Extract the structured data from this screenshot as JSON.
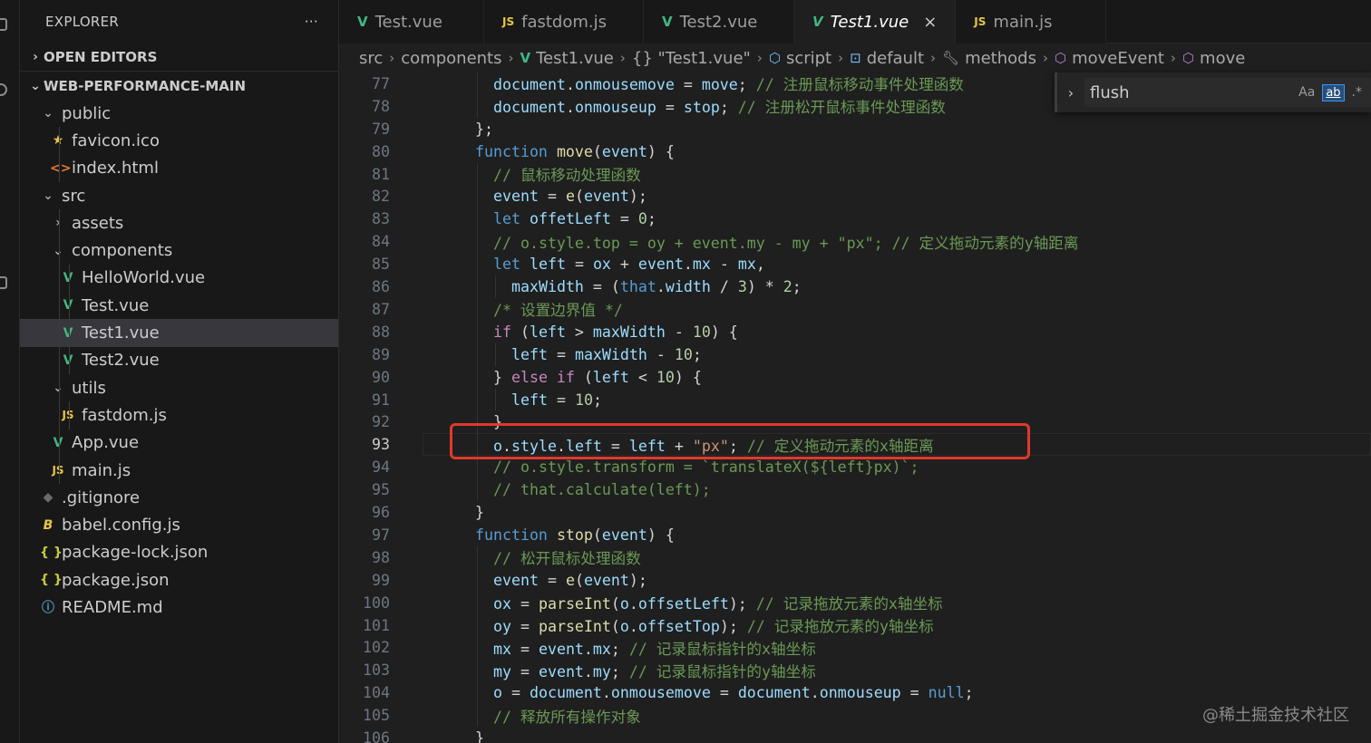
{
  "sidebar": {
    "title": "EXPLORER",
    "more": "···",
    "open_editors": "OPEN EDITORS",
    "project": "WEB-PERFORMANCE-MAIN",
    "items": [
      {
        "label": "public",
        "type": "folder-open",
        "depth": 1
      },
      {
        "label": "favicon.ico",
        "type": "star-file",
        "depth": 2
      },
      {
        "label": "index.html",
        "type": "html-file",
        "depth": 2
      },
      {
        "label": "src",
        "type": "folder-open",
        "depth": 1
      },
      {
        "label": "assets",
        "type": "folder-closed",
        "depth": 2
      },
      {
        "label": "components",
        "type": "folder-open",
        "depth": 2
      },
      {
        "label": "HelloWorld.vue",
        "type": "vue-file",
        "depth": 3
      },
      {
        "label": "Test.vue",
        "type": "vue-file",
        "depth": 3
      },
      {
        "label": "Test1.vue",
        "type": "vue-file",
        "depth": 3,
        "selected": true
      },
      {
        "label": "Test2.vue",
        "type": "vue-file",
        "depth": 3
      },
      {
        "label": "utils",
        "type": "folder-open",
        "depth": 2
      },
      {
        "label": "fastdom.js",
        "type": "js-file",
        "depth": 3
      },
      {
        "label": "App.vue",
        "type": "vue-file",
        "depth": 2
      },
      {
        "label": "main.js",
        "type": "js-file",
        "depth": 2
      },
      {
        "label": ".gitignore",
        "type": "git-file",
        "depth": 1
      },
      {
        "label": "babel.config.js",
        "type": "babel-file",
        "depth": 1
      },
      {
        "label": "package-lock.json",
        "type": "json-file",
        "depth": 1
      },
      {
        "label": "package.json",
        "type": "json-file",
        "depth": 1
      },
      {
        "label": "README.md",
        "type": "info-file",
        "depth": 1
      }
    ]
  },
  "tabs": [
    {
      "label": "Test.vue",
      "icon": "vue-icon"
    },
    {
      "label": "fastdom.js",
      "icon": "js-icon"
    },
    {
      "label": "Test2.vue",
      "icon": "vue-icon"
    },
    {
      "label": "Test1.vue",
      "icon": "vue-icon",
      "active": true
    },
    {
      "label": "main.js",
      "icon": "js-icon"
    }
  ],
  "icons": {
    "vue": "V",
    "js": "JS",
    "close": "×",
    "star": "★",
    "html": "<>",
    "json": "{ }",
    "babel": "B",
    "git": "◆",
    "info": "ⓘ"
  },
  "breadcrumb": {
    "src": "src",
    "components": "components",
    "file": "Test1.vue",
    "obj": "{} \"Test1.vue\"",
    "script": "script",
    "default": "default",
    "methods": "methods",
    "moveEvent": "moveEvent",
    "move": "move"
  },
  "find": {
    "query": "flush",
    "match_case": "Aa",
    "whole_word": "ab",
    "regex": ".*"
  },
  "editor": {
    "current_line": 93,
    "lines": [
      {
        "n": "77",
        "indent": 1,
        "tokens": [
          [
            "var",
            "document"
          ],
          [
            "pn",
            "."
          ],
          [
            "var",
            "onmousemove"
          ],
          [
            "pn",
            " = "
          ],
          [
            "var",
            "move"
          ],
          [
            "pn",
            "; "
          ],
          [
            "cm",
            "// 注册鼠标移动事件处理函数"
          ]
        ]
      },
      {
        "n": "78",
        "indent": 1,
        "tokens": [
          [
            "var",
            "document"
          ],
          [
            "pn",
            "."
          ],
          [
            "var",
            "onmouseup"
          ],
          [
            "pn",
            " = "
          ],
          [
            "var",
            "stop"
          ],
          [
            "pn",
            "; "
          ],
          [
            "cm",
            "// 注册松开鼠标事件处理函数"
          ]
        ]
      },
      {
        "n": "79",
        "indent": 0,
        "tokens": [
          [
            "pn",
            "};"
          ]
        ]
      },
      {
        "n": "80",
        "indent": 0,
        "tokens": [
          [
            "kw",
            "function"
          ],
          [
            "pn",
            " "
          ],
          [
            "fn",
            "move"
          ],
          [
            "pn",
            "("
          ],
          [
            "var",
            "event"
          ],
          [
            "pn",
            ") {"
          ]
        ]
      },
      {
        "n": "81",
        "indent": 1,
        "tokens": [
          [
            "cm",
            "// 鼠标移动处理函数"
          ]
        ]
      },
      {
        "n": "82",
        "indent": 1,
        "tokens": [
          [
            "var",
            "event"
          ],
          [
            "pn",
            " = "
          ],
          [
            "fn",
            "e"
          ],
          [
            "pn",
            "("
          ],
          [
            "var",
            "event"
          ],
          [
            "pn",
            ");"
          ]
        ]
      },
      {
        "n": "83",
        "indent": 1,
        "tokens": [
          [
            "kw",
            "let"
          ],
          [
            "pn",
            " "
          ],
          [
            "var",
            "offetLeft"
          ],
          [
            "pn",
            " = "
          ],
          [
            "num",
            "0"
          ],
          [
            "pn",
            ";"
          ]
        ]
      },
      {
        "n": "84",
        "indent": 1,
        "tokens": [
          [
            "cm",
            "// o.style.top = oy + event.my - my + \"px\"; // 定义拖动元素的y轴距离"
          ]
        ]
      },
      {
        "n": "85",
        "indent": 1,
        "tokens": [
          [
            "kw",
            "let"
          ],
          [
            "pn",
            " "
          ],
          [
            "var",
            "left"
          ],
          [
            "pn",
            " = "
          ],
          [
            "var",
            "ox"
          ],
          [
            "pn",
            " + "
          ],
          [
            "var",
            "event"
          ],
          [
            "pn",
            "."
          ],
          [
            "var",
            "mx"
          ],
          [
            "pn",
            " - "
          ],
          [
            "var",
            "mx"
          ],
          [
            "pn",
            ","
          ]
        ]
      },
      {
        "n": "86",
        "indent": 2,
        "tokens": [
          [
            "var",
            "maxWidth"
          ],
          [
            "pn",
            " = ("
          ],
          [
            "kw",
            "that"
          ],
          [
            "pn",
            "."
          ],
          [
            "var",
            "width"
          ],
          [
            "pn",
            " / "
          ],
          [
            "num",
            "3"
          ],
          [
            "pn",
            ") * "
          ],
          [
            "num",
            "2"
          ],
          [
            "pn",
            ";"
          ]
        ]
      },
      {
        "n": "87",
        "indent": 1,
        "tokens": [
          [
            "cm",
            "/* 设置边界值 */"
          ]
        ]
      },
      {
        "n": "88",
        "indent": 1,
        "tokens": [
          [
            "kw2",
            "if"
          ],
          [
            "pn",
            " ("
          ],
          [
            "var",
            "left"
          ],
          [
            "pn",
            " > "
          ],
          [
            "var",
            "maxWidth"
          ],
          [
            "pn",
            " - "
          ],
          [
            "num",
            "10"
          ],
          [
            "pn",
            ") {"
          ]
        ]
      },
      {
        "n": "89",
        "indent": 2,
        "tokens": [
          [
            "var",
            "left"
          ],
          [
            "pn",
            " = "
          ],
          [
            "var",
            "maxWidth"
          ],
          [
            "pn",
            " - "
          ],
          [
            "num",
            "10"
          ],
          [
            "pn",
            ";"
          ]
        ]
      },
      {
        "n": "90",
        "indent": 1,
        "tokens": [
          [
            "pn",
            "} "
          ],
          [
            "kw2",
            "else if"
          ],
          [
            "pn",
            " ("
          ],
          [
            "var",
            "left"
          ],
          [
            "pn",
            " < "
          ],
          [
            "num",
            "10"
          ],
          [
            "pn",
            ") {"
          ]
        ]
      },
      {
        "n": "91",
        "indent": 2,
        "tokens": [
          [
            "var",
            "left"
          ],
          [
            "pn",
            " = "
          ],
          [
            "num",
            "10"
          ],
          [
            "pn",
            ";"
          ]
        ]
      },
      {
        "n": "92",
        "indent": 1,
        "tokens": [
          [
            "pn",
            "}"
          ]
        ]
      },
      {
        "n": "93",
        "indent": 1,
        "tokens": [
          [
            "var",
            "o"
          ],
          [
            "pn",
            "."
          ],
          [
            "var",
            "style"
          ],
          [
            "pn",
            "."
          ],
          [
            "var",
            "left"
          ],
          [
            "pn",
            " = "
          ],
          [
            "var",
            "left"
          ],
          [
            "pn",
            " + "
          ],
          [
            "str",
            "\"px\""
          ],
          [
            "pn",
            "; "
          ],
          [
            "cm",
            "// 定义拖动元素的x轴距离"
          ]
        ]
      },
      {
        "n": "94",
        "indent": 1,
        "tokens": [
          [
            "cm",
            "// o.style.transform = `translateX(${left}px)`;"
          ]
        ]
      },
      {
        "n": "95",
        "indent": 1,
        "tokens": [
          [
            "cm",
            "// that.calculate(left);"
          ]
        ]
      },
      {
        "n": "96",
        "indent": 0,
        "tokens": [
          [
            "pn",
            "}"
          ]
        ]
      },
      {
        "n": "97",
        "indent": 0,
        "tokens": [
          [
            "kw",
            "function"
          ],
          [
            "pn",
            " "
          ],
          [
            "fn",
            "stop"
          ],
          [
            "pn",
            "("
          ],
          [
            "var",
            "event"
          ],
          [
            "pn",
            ") {"
          ]
        ]
      },
      {
        "n": "98",
        "indent": 1,
        "tokens": [
          [
            "cm",
            "// 松开鼠标处理函数"
          ]
        ]
      },
      {
        "n": "99",
        "indent": 1,
        "tokens": [
          [
            "var",
            "event"
          ],
          [
            "pn",
            " = "
          ],
          [
            "fn",
            "e"
          ],
          [
            "pn",
            "("
          ],
          [
            "var",
            "event"
          ],
          [
            "pn",
            ");"
          ]
        ]
      },
      {
        "n": "100",
        "indent": 1,
        "tokens": [
          [
            "var",
            "ox"
          ],
          [
            "pn",
            " = "
          ],
          [
            "fn",
            "parseInt"
          ],
          [
            "pn",
            "("
          ],
          [
            "var",
            "o"
          ],
          [
            "pn",
            "."
          ],
          [
            "var",
            "offsetLeft"
          ],
          [
            "pn",
            "); "
          ],
          [
            "cm",
            "// 记录拖放元素的x轴坐标"
          ]
        ]
      },
      {
        "n": "101",
        "indent": 1,
        "tokens": [
          [
            "var",
            "oy"
          ],
          [
            "pn",
            " = "
          ],
          [
            "fn",
            "parseInt"
          ],
          [
            "pn",
            "("
          ],
          [
            "var",
            "o"
          ],
          [
            "pn",
            "."
          ],
          [
            "var",
            "offsetTop"
          ],
          [
            "pn",
            "); "
          ],
          [
            "cm",
            "// 记录拖放元素的y轴坐标"
          ]
        ]
      },
      {
        "n": "102",
        "indent": 1,
        "tokens": [
          [
            "var",
            "mx"
          ],
          [
            "pn",
            " = "
          ],
          [
            "var",
            "event"
          ],
          [
            "pn",
            "."
          ],
          [
            "var",
            "mx"
          ],
          [
            "pn",
            "; "
          ],
          [
            "cm",
            "// 记录鼠标指针的x轴坐标"
          ]
        ]
      },
      {
        "n": "103",
        "indent": 1,
        "tokens": [
          [
            "var",
            "my"
          ],
          [
            "pn",
            " = "
          ],
          [
            "var",
            "event"
          ],
          [
            "pn",
            "."
          ],
          [
            "var",
            "my"
          ],
          [
            "pn",
            "; "
          ],
          [
            "cm",
            "// 记录鼠标指针的y轴坐标"
          ]
        ]
      },
      {
        "n": "104",
        "indent": 1,
        "tokens": [
          [
            "var",
            "o"
          ],
          [
            "pn",
            " = "
          ],
          [
            "var",
            "document"
          ],
          [
            "pn",
            "."
          ],
          [
            "var",
            "onmousemove"
          ],
          [
            "pn",
            " = "
          ],
          [
            "var",
            "document"
          ],
          [
            "pn",
            "."
          ],
          [
            "var",
            "onmouseup"
          ],
          [
            "pn",
            " = "
          ],
          [
            "kw",
            "null"
          ],
          [
            "pn",
            ";"
          ]
        ]
      },
      {
        "n": "105",
        "indent": 1,
        "tokens": [
          [
            "cm",
            "// 释放所有操作对象"
          ]
        ]
      },
      {
        "n": "106",
        "indent": 0,
        "tokens": [
          [
            "pn",
            "}"
          ]
        ]
      }
    ]
  },
  "watermark": "@稀土掘金技术社区",
  "colors": {
    "accent_highlight": "#e0392b",
    "vue_green": "#41b883",
    "js_yellow": "#e8c547"
  }
}
